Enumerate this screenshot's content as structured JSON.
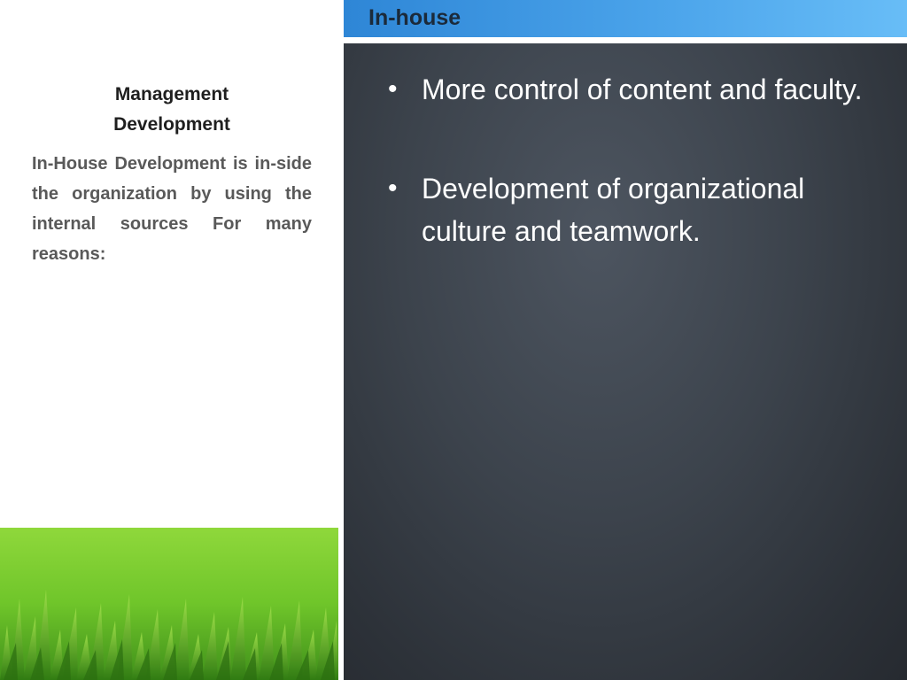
{
  "header": {
    "title": "In-house",
    "accent_color": "#3b97e2"
  },
  "left": {
    "title_line1": "Management",
    "title_line2": "Development",
    "body": "In-House Development is in-side the organization by using the internal sources For many reasons:"
  },
  "main": {
    "bullets": [
      {
        "text": "More control of content and faculty."
      },
      {
        "text": "Development of organizational culture and teamwork."
      }
    ],
    "bullet_glyph": "•",
    "panel_color": "#3a4048"
  },
  "decoration": {
    "image": "grass-illustration",
    "grass_color": "#6cc12a"
  }
}
